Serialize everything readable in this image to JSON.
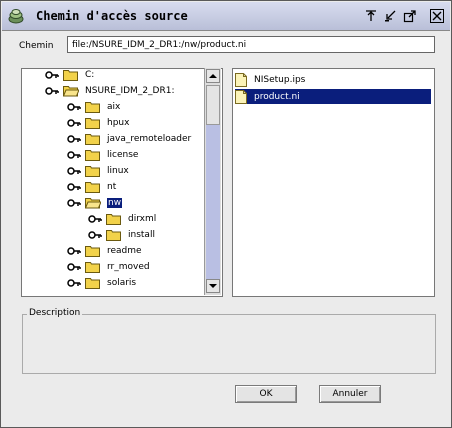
{
  "window": {
    "title": "Chemin d'accès source"
  },
  "title_buttons": [
    "pin-icon",
    "minimize-icon",
    "maximize-icon",
    "close-icon"
  ],
  "path": {
    "label": "Chemin",
    "value": "file:/NSURE_IDM_2_DR1:/nw/product.ni"
  },
  "tree": {
    "items": [
      {
        "label": "C:",
        "depth": 0
      },
      {
        "label": "NSURE_IDM_2_DR1:",
        "depth": 0,
        "expanded": true
      },
      {
        "label": "aix",
        "depth": 1
      },
      {
        "label": "hpux",
        "depth": 1
      },
      {
        "label": "java_remoteloader",
        "depth": 1
      },
      {
        "label": "license",
        "depth": 1
      },
      {
        "label": "linux",
        "depth": 1
      },
      {
        "label": "nt",
        "depth": 1
      },
      {
        "label": "nw",
        "depth": 1,
        "expanded": true,
        "selected": true
      },
      {
        "label": "dirxml",
        "depth": 2
      },
      {
        "label": "install",
        "depth": 2
      },
      {
        "label": "readme",
        "depth": 1
      },
      {
        "label": "rr_moved",
        "depth": 1
      },
      {
        "label": "solaris",
        "depth": 1
      }
    ]
  },
  "files": {
    "items": [
      {
        "label": "NISetup.ips",
        "selected": false
      },
      {
        "label": "product.ni",
        "selected": true
      }
    ]
  },
  "description": {
    "label": "Description"
  },
  "buttons": {
    "ok": "OK",
    "cancel": "Annuler"
  },
  "colors": {
    "selection": "#0a1e7c",
    "scroll_track": "#b9bfe3",
    "folder": "#f2d24a"
  }
}
